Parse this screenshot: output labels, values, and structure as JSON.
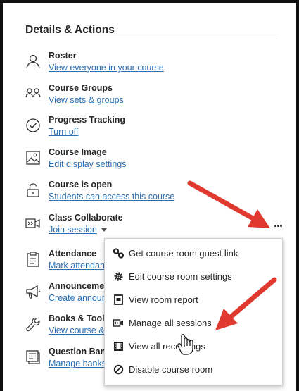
{
  "panel": {
    "heading": "Details & Actions"
  },
  "items": [
    {
      "icon": "roster-icon",
      "title": "Roster",
      "link": "View everyone in your course"
    },
    {
      "icon": "course-groups-icon",
      "title": "Course Groups",
      "link": "View sets & groups"
    },
    {
      "icon": "progress-check-icon",
      "title": "Progress Tracking",
      "link": "Turn off"
    },
    {
      "icon": "image-icon",
      "title": "Course Image",
      "link": "Edit display settings"
    },
    {
      "icon": "unlock-icon",
      "title": "Course is open",
      "link": "Students can access this course"
    },
    {
      "icon": "video-icon",
      "title": "Class Collaborate",
      "link": "Join session"
    },
    {
      "icon": "clipboard-icon",
      "title": "Attendance",
      "link": "Mark attendance"
    },
    {
      "icon": "megaphone-icon",
      "title": "Announcements",
      "link": "Create announcement"
    },
    {
      "icon": "wrench-icon",
      "title": "Books & Tools",
      "link": "View course & institution tools"
    },
    {
      "icon": "question-bank-icon",
      "title": "Question Banks",
      "link": "Manage banks"
    }
  ],
  "more_options": "...",
  "menu": {
    "items": [
      {
        "icon": "link-icon",
        "label": "Get course room guest link"
      },
      {
        "icon": "settings-icon",
        "label": "Edit course room settings"
      },
      {
        "icon": "report-icon",
        "label": "View room report"
      },
      {
        "icon": "sessions-icon",
        "label": "Manage all sessions"
      },
      {
        "icon": "film-icon",
        "label": "View all recordings"
      },
      {
        "icon": "disable-icon",
        "label": "Disable course room"
      }
    ]
  },
  "colors": {
    "link": "#2a6fb3",
    "arrow": "#e03a30",
    "text": "#262626"
  }
}
